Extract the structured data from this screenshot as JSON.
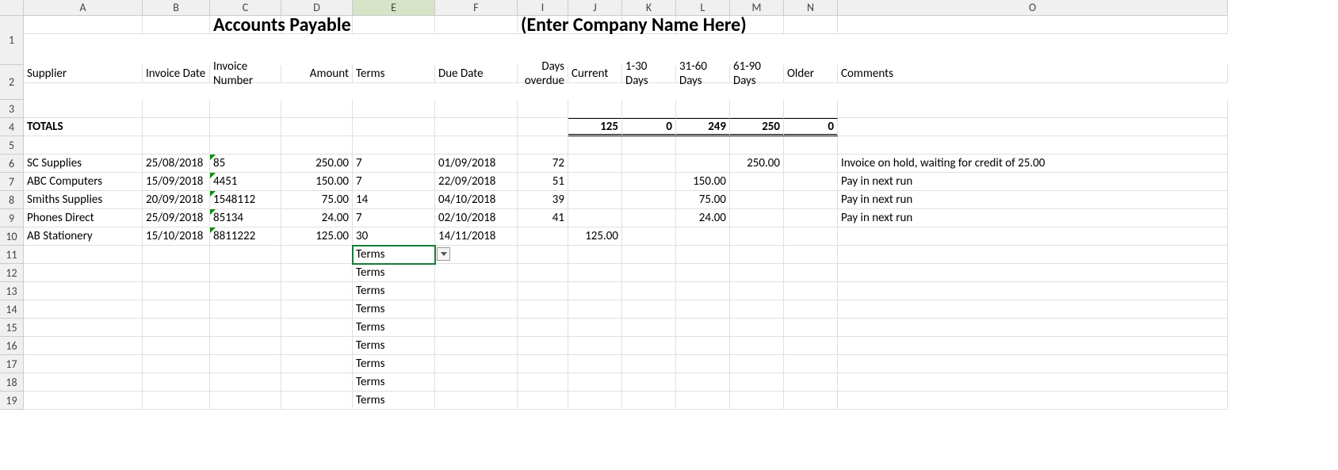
{
  "cols": [
    "A",
    "B",
    "C",
    "D",
    "E",
    "F",
    "I",
    "J",
    "K",
    "L",
    "M",
    "N",
    "O"
  ],
  "rowNums": [
    1,
    2,
    3,
    4,
    5,
    6,
    7,
    8,
    9,
    10,
    11,
    12,
    13,
    14,
    15,
    16,
    17,
    18,
    19
  ],
  "title1": "Accounts Payable",
  "title2": "(Enter Company Name Here)",
  "headers": {
    "supplier": "Supplier",
    "invDate": "Invoice Date",
    "invNum": "Invoice Number",
    "amount": "Amount",
    "terms": "Terms",
    "dueDate": "Due Date",
    "daysOver": "Days overdue",
    "current": "Current",
    "d1_30": "1-30 Days",
    "d31_60": "31-60 Days",
    "d61_90": "61-90 Days",
    "older": "Older",
    "comments": "Comments"
  },
  "totalsLabel": "TOTALS",
  "totals": {
    "current": "125",
    "d1_30": "0",
    "d31_60": "249",
    "d61_90": "250",
    "older": "0"
  },
  "rows": [
    {
      "supplier": "SC Supplies",
      "invDate": "25/08/2018",
      "invNum": "85",
      "amount": "250.00",
      "terms": "7",
      "dueDate": "01/09/2018",
      "daysOver": "72",
      "current": "",
      "d1_30": "",
      "d31_60": "",
      "d61_90": "250.00",
      "older": "",
      "comments": "Invoice on hold, waiting for credit of 25.00"
    },
    {
      "supplier": "ABC Computers",
      "invDate": "15/09/2018",
      "invNum": "4451",
      "amount": "150.00",
      "terms": "7",
      "dueDate": "22/09/2018",
      "daysOver": "51",
      "current": "",
      "d1_30": "",
      "d31_60": "150.00",
      "d61_90": "",
      "older": "",
      "comments": "Pay in next run"
    },
    {
      "supplier": "Smiths Supplies",
      "invDate": "20/09/2018",
      "invNum": "1548112",
      "amount": "75.00",
      "terms": "14",
      "dueDate": "04/10/2018",
      "daysOver": "39",
      "current": "",
      "d1_30": "",
      "d31_60": "75.00",
      "d61_90": "",
      "older": "",
      "comments": "Pay in next run"
    },
    {
      "supplier": "Phones Direct",
      "invDate": "25/09/2018",
      "invNum": "85134",
      "amount": "24.00",
      "terms": "7",
      "dueDate": "02/10/2018",
      "daysOver": "41",
      "current": "",
      "d1_30": "",
      "d31_60": "24.00",
      "d61_90": "",
      "older": "",
      "comments": "Pay in next run"
    },
    {
      "supplier": "AB Stationery",
      "invDate": "15/10/2018",
      "invNum": "8811222",
      "amount": "125.00",
      "terms": "30",
      "dueDate": "14/11/2018",
      "daysOver": "",
      "current": "125.00",
      "d1_30": "",
      "d31_60": "",
      "d61_90": "",
      "older": "",
      "comments": ""
    }
  ],
  "termsDefault": "Terms"
}
